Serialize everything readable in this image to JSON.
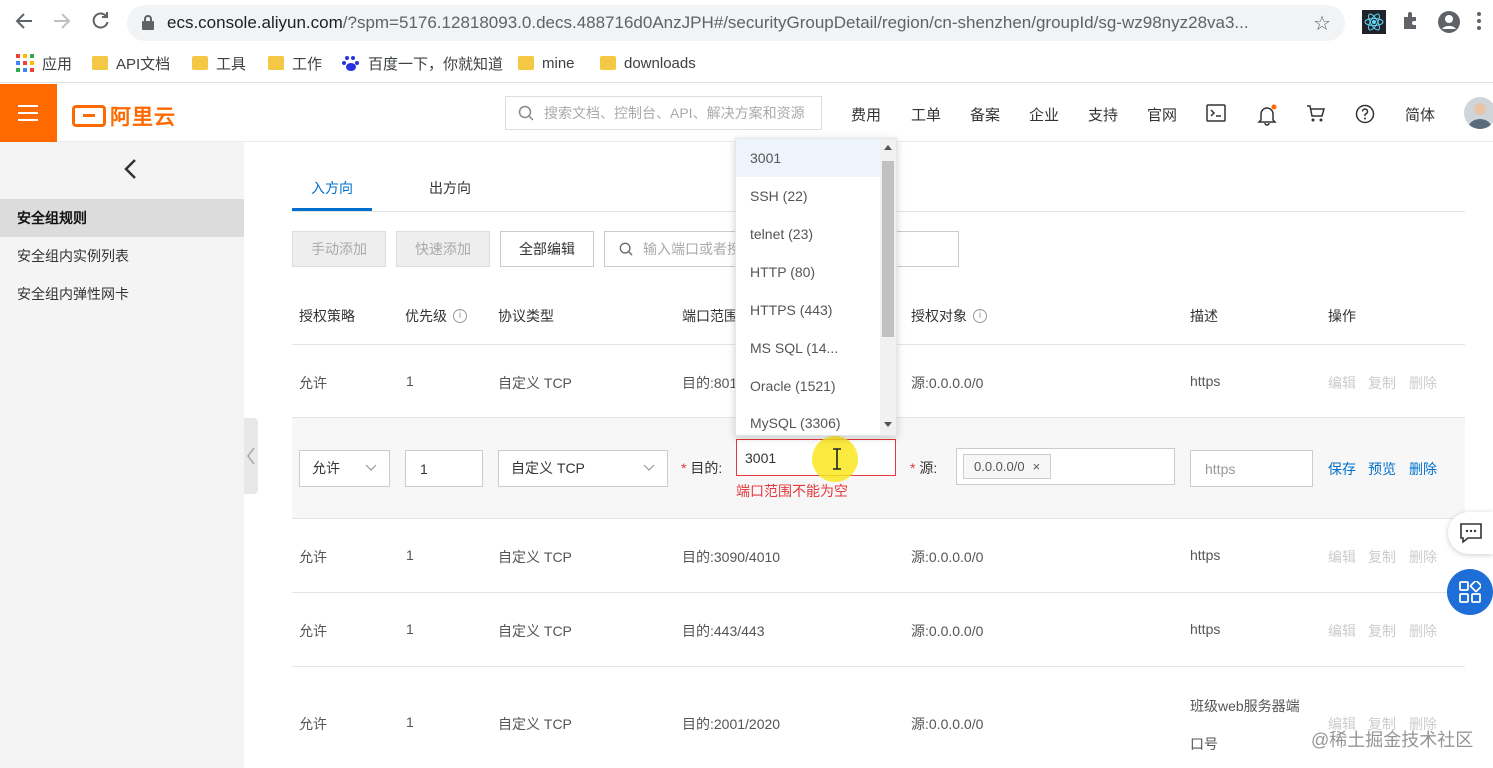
{
  "browser": {
    "url_domain": "ecs.console.aliyun.com",
    "url_rest": "/?spm=5176.12818093.0.decs.488716d0AnzJPH#/securityGroupDetail/region/cn-shenzhen/groupId/sg-wz98nyz28va3...",
    "bookmarks": [
      "应用",
      "API文档",
      "工具",
      "工作",
      "百度一下，你就知道",
      "mine",
      "downloads"
    ]
  },
  "header": {
    "logo": "阿里云",
    "search_placeholder": "搜索文档、控制台、API、解决方案和资源",
    "nav": [
      "费用",
      "工单",
      "备案",
      "企业",
      "支持",
      "官网"
    ],
    "lang": "简体"
  },
  "sidebar": {
    "items": [
      "安全组规则",
      "安全组内实例列表",
      "安全组内弹性网卡"
    ]
  },
  "tabs": [
    "入方向",
    "出方向"
  ],
  "toolbar": {
    "manual_add": "手动添加",
    "quick_add": "快速添加",
    "edit_all": "全部编辑",
    "search_placeholder": "输入端口或者授"
  },
  "table": {
    "headers": [
      "授权策略",
      "优先级",
      "协议类型",
      "端口范围",
      "授权对象",
      "描述",
      "操作"
    ],
    "row1": {
      "policy": "允许",
      "priority": "1",
      "protocol": "自定义 TCP",
      "port": "目的:801",
      "source": "源:0.0.0.0/0",
      "desc": "https"
    },
    "rows": [
      {
        "policy": "允许",
        "priority": "1",
        "protocol": "自定义 TCP",
        "port": "目的:3090/4010",
        "source": "源:0.0.0.0/0",
        "desc": "https"
      },
      {
        "policy": "允许",
        "priority": "1",
        "protocol": "自定义 TCP",
        "port": "目的:443/443",
        "source": "源:0.0.0.0/0",
        "desc": "https"
      },
      {
        "policy": "允许",
        "priority": "1",
        "protocol": "自定义 TCP",
        "port": "目的:2001/2020",
        "source": "源:0.0.0.0/0",
        "desc_line1": "班级web服务器端",
        "desc_line2": "口号"
      }
    ],
    "ops": {
      "edit": "编辑",
      "copy": "复制",
      "delete": "删除"
    }
  },
  "edit_row": {
    "policy": "允许",
    "priority": "1",
    "protocol": "自定义 TCP",
    "dest_label": "目的:",
    "dest_value": "3001",
    "error": "端口范围不能为空",
    "src_label": "源:",
    "src_tag": "0.0.0.0/0",
    "desc_value": "https",
    "save": "保存",
    "preview": "预览",
    "delete": "删除",
    "required_mark": "*"
  },
  "dropdown": {
    "options": [
      "3001",
      "SSH (22)",
      "telnet (23)",
      "HTTP (80)",
      "HTTPS (443)",
      "MS SQL (14...",
      "Oracle (1521)",
      "MySQL (3306)"
    ]
  },
  "watermark": "@稀土掘金技术社区"
}
